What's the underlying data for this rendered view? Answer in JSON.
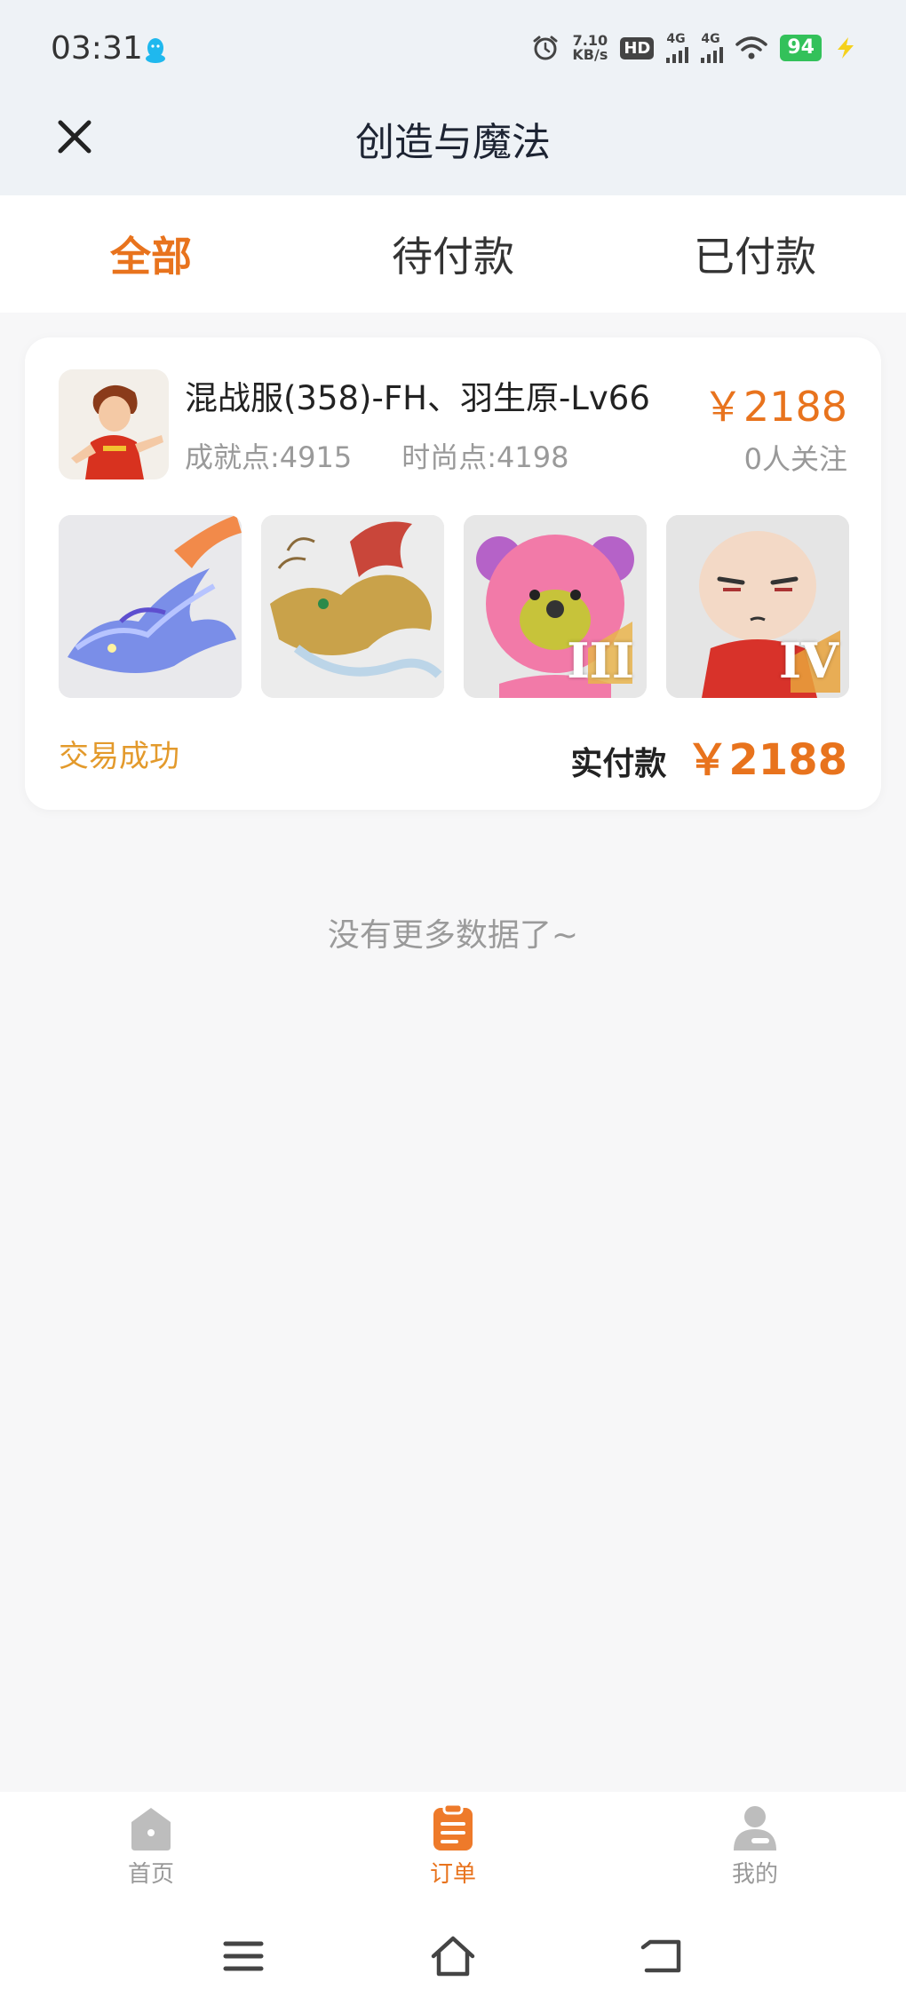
{
  "status_bar": {
    "time": "03:31",
    "net_speed_value": "7.10",
    "net_speed_unit": "KB/s",
    "hd_label": "HD",
    "hd_sub": "1\n2",
    "sig1_label": "4G",
    "sig2_label": "4G",
    "battery": "94"
  },
  "header": {
    "title": "创造与魔法",
    "close_icon": "close-icon"
  },
  "tabs": [
    {
      "label": "全部",
      "active": true
    },
    {
      "label": "待付款",
      "active": false
    },
    {
      "label": "已付款",
      "active": false
    }
  ],
  "order": {
    "server_name": "混战服(358)-FH、羽生原-Lv66",
    "achievement": "成就点:4915",
    "fashion": "时尚点:4198",
    "price": "￥2188",
    "followers": "0人关注",
    "thumb_badges": [
      "",
      "",
      "III",
      "IV"
    ],
    "status": "交易成功",
    "paid_label": "实付款",
    "paid_amount": "￥2188"
  },
  "list_end_text": "没有更多数据了~",
  "bottom_nav": [
    {
      "label": "首页",
      "icon": "home-icon",
      "active": false
    },
    {
      "label": "订单",
      "icon": "order-icon",
      "active": true
    },
    {
      "label": "我的",
      "icon": "profile-icon",
      "active": false
    }
  ],
  "colors": {
    "accent": "#e8731d",
    "status_success": "#e39a2c",
    "header_bg": "#eef2f6"
  }
}
